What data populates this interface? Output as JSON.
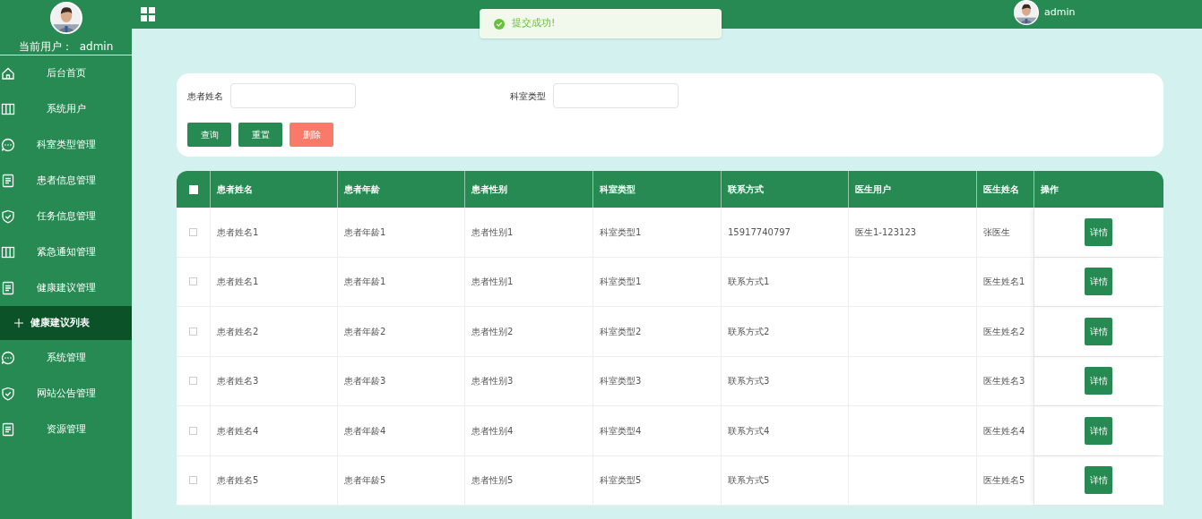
{
  "sidebar": {
    "current_user_label": "当前用户：",
    "current_user": "admin",
    "items": [
      {
        "label": "后台首页"
      },
      {
        "label": "系统用户"
      },
      {
        "label": "科室类型管理"
      },
      {
        "label": "患者信息管理"
      },
      {
        "label": "任务信息管理"
      },
      {
        "label": "紧急通知管理"
      },
      {
        "label": "健康建议管理",
        "children": [
          {
            "label": "健康建议列表",
            "selected": true
          }
        ]
      },
      {
        "label": "系统管理"
      },
      {
        "label": "网站公告管理"
      },
      {
        "label": "资源管理"
      }
    ]
  },
  "topbar": {
    "user": "admin"
  },
  "toast": {
    "message": "提交成功!"
  },
  "search": {
    "fields": [
      {
        "label": "患者姓名"
      },
      {
        "label": "科室类型"
      }
    ],
    "buttons": [
      {
        "label": "查询",
        "kind": "primary"
      },
      {
        "label": "重置",
        "kind": "primary"
      },
      {
        "label": "删除",
        "kind": "danger"
      }
    ]
  },
  "table": {
    "all_checked": false,
    "columns": [
      "患者姓名",
      "患者年龄",
      "患者性别",
      "科室类型",
      "联系方式",
      "医生用户",
      "医生姓名",
      "操作"
    ],
    "rows": [
      {
        "checked": false,
        "cells": [
          "患者姓名1",
          "患者年龄1",
          "患者性别1",
          "科室类型1",
          "15917740797",
          "医生1-123123",
          "张医生"
        ],
        "action": "详情"
      },
      {
        "checked": false,
        "cells": [
          "患者姓名1",
          "患者年龄1",
          "患者性别1",
          "科室类型1",
          "联系方式1",
          "",
          "医生姓名1"
        ],
        "action": "详情"
      },
      {
        "checked": false,
        "cells": [
          "患者姓名2",
          "患者年龄2",
          "患者性别2",
          "科室类型2",
          "联系方式2",
          "",
          "医生姓名2"
        ],
        "action": "详情"
      },
      {
        "checked": false,
        "cells": [
          "患者姓名3",
          "患者年龄3",
          "患者性别3",
          "科室类型3",
          "联系方式3",
          "",
          "医生姓名3"
        ],
        "action": "详情"
      },
      {
        "checked": false,
        "cells": [
          "患者姓名4",
          "患者年龄4",
          "患者性别4",
          "科室类型4",
          "联系方式4",
          "",
          "医生姓名4"
        ],
        "action": "详情"
      },
      {
        "checked": false,
        "cells": [
          "患者姓名5",
          "患者年龄5",
          "患者性别5",
          "科室类型5",
          "联系方式5",
          "",
          "医生姓名5"
        ],
        "action": "详情"
      }
    ]
  }
}
